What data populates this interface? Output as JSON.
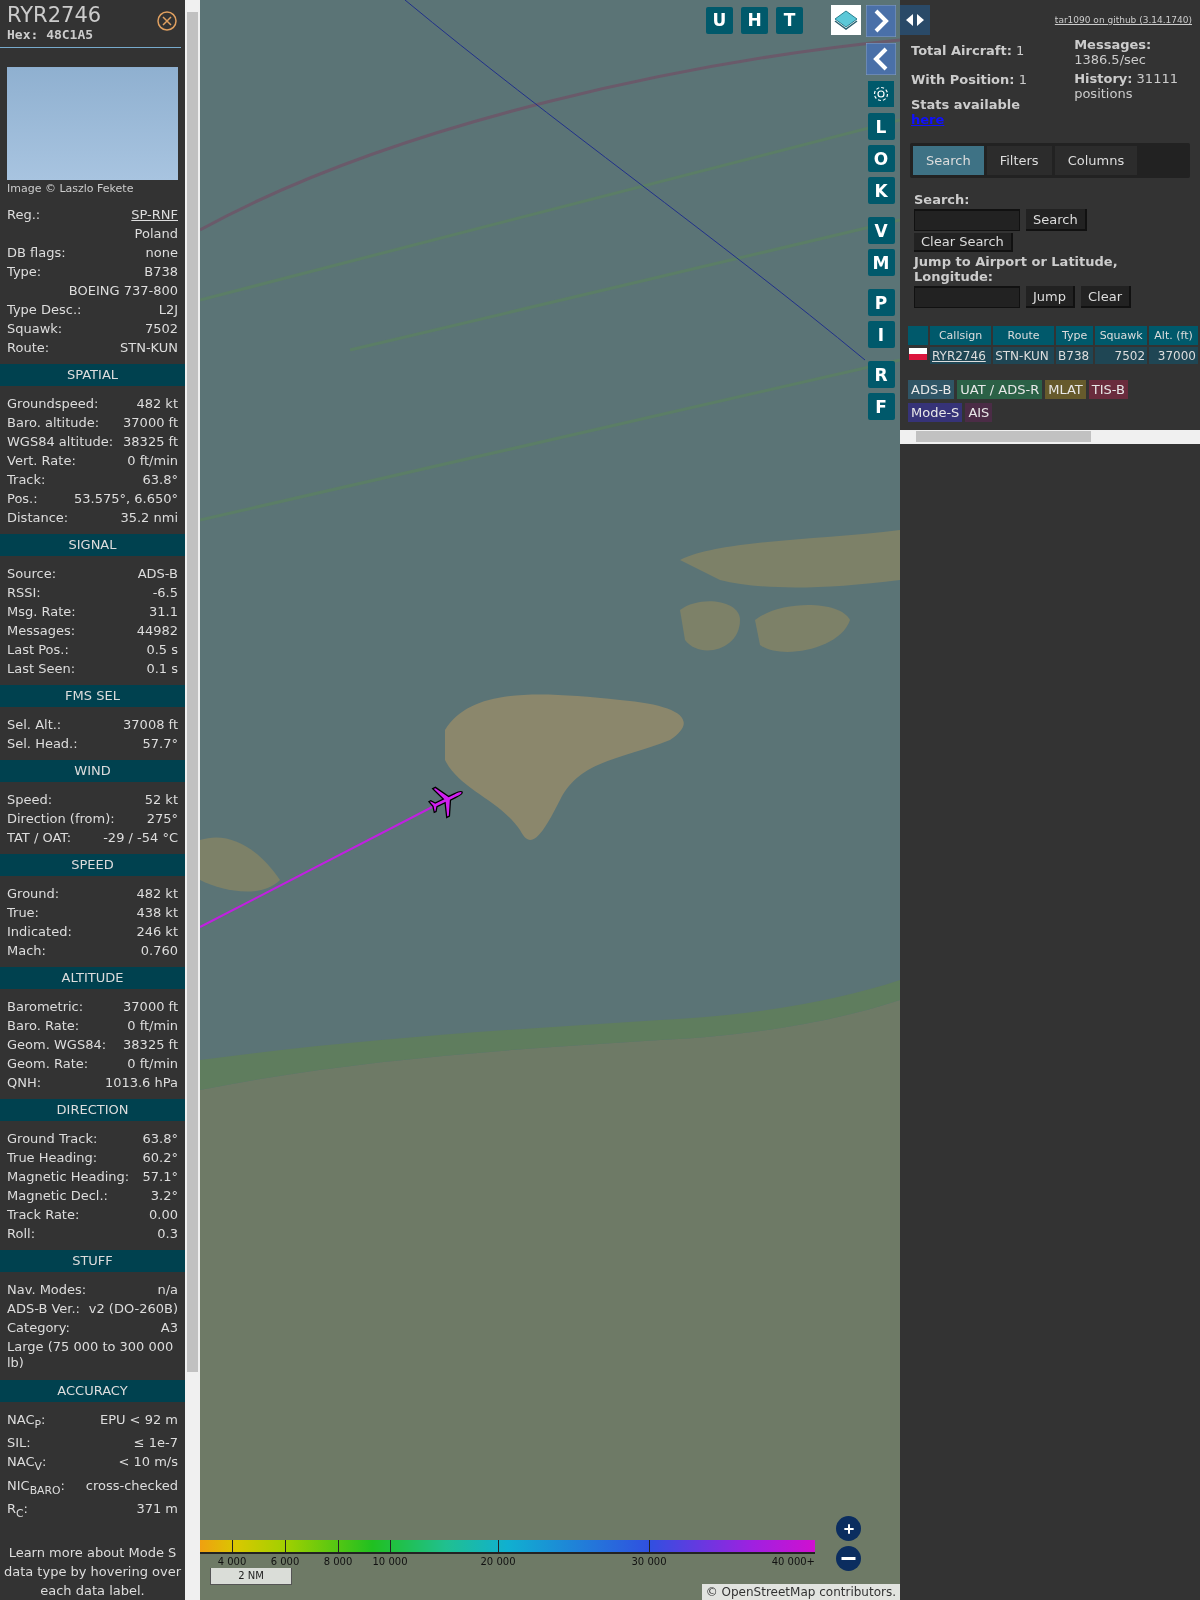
{
  "sidebar": {
    "title": "RYR2746",
    "hex": "Hex: 48C1A5",
    "photo_credit": "Image © Laszlo Fekete",
    "details": [
      {
        "kind": "link",
        "label": "Reg.:",
        "value": "SP-RNF"
      },
      {
        "kind": "value",
        "value": "Poland"
      },
      {
        "kind": "pair",
        "label": "DB flags:",
        "value": "none"
      },
      {
        "kind": "pair",
        "label": "Type:",
        "value": "B738"
      },
      {
        "kind": "value",
        "value": "BOEING 737-800"
      },
      {
        "kind": "pair",
        "label": "Type Desc.:",
        "value": "L2J"
      },
      {
        "kind": "pair",
        "label": "Squawk:",
        "value": "7502"
      },
      {
        "kind": "pair",
        "label": "Route:",
        "value": "STN-KUN"
      }
    ],
    "sections": [
      {
        "title": "SPATIAL",
        "rows": [
          {
            "kind": "pair",
            "label": "Groundspeed:",
            "value": "482 kt"
          },
          {
            "kind": "pair",
            "label": "Baro. altitude:",
            "value": "37000 ft"
          },
          {
            "kind": "pair",
            "label": "WGS84 altitude:",
            "value": "38325 ft"
          },
          {
            "kind": "pair",
            "label": "Vert. Rate:",
            "value": "0 ft/min"
          },
          {
            "kind": "pair",
            "label": "Track:",
            "value": "63.8°"
          },
          {
            "kind": "pair",
            "label": "Pos.:",
            "value": "53.575°, 6.650°"
          },
          {
            "kind": "pair",
            "label": "Distance:",
            "value": "35.2 nmi"
          }
        ]
      },
      {
        "title": "SIGNAL",
        "rows": [
          {
            "kind": "pair",
            "label": "Source:",
            "value": "ADS-B"
          },
          {
            "kind": "pair",
            "label": "RSSI:",
            "value": "-6.5"
          },
          {
            "kind": "pair",
            "label": "Msg. Rate:",
            "value": "31.1"
          },
          {
            "kind": "pair",
            "label": "Messages:",
            "value": "44982"
          },
          {
            "kind": "pair",
            "label": "Last Pos.:",
            "value": "0.5 s"
          },
          {
            "kind": "pair",
            "label": "Last Seen:",
            "value": "0.1 s"
          }
        ]
      },
      {
        "title": "FMS SEL",
        "rows": [
          {
            "kind": "pair",
            "label": "Sel. Alt.:",
            "value": "37008 ft"
          },
          {
            "kind": "pair",
            "label": "Sel. Head.:",
            "value": "57.7°"
          }
        ]
      },
      {
        "title": "WIND",
        "rows": [
          {
            "kind": "pair",
            "label": "Speed:",
            "value": "52 kt"
          },
          {
            "kind": "pair",
            "label": "Direction (from):",
            "value": "275°"
          },
          {
            "kind": "pair",
            "label": "TAT / OAT:",
            "value": "-29 / -54 °C"
          }
        ]
      },
      {
        "title": "SPEED",
        "rows": [
          {
            "kind": "pair",
            "label": "Ground:",
            "value": "482 kt"
          },
          {
            "kind": "pair",
            "label": "True:",
            "value": "438 kt"
          },
          {
            "kind": "pair",
            "label": "Indicated:",
            "value": "246 kt"
          },
          {
            "kind": "pair",
            "label": "Mach:",
            "value": "0.760"
          }
        ]
      },
      {
        "title": "ALTITUDE",
        "rows": [
          {
            "kind": "pair",
            "label": "Barometric:",
            "value": "37000 ft"
          },
          {
            "kind": "pair",
            "label": "Baro. Rate:",
            "value": "0 ft/min"
          },
          {
            "kind": "pair",
            "label": "Geom. WGS84:",
            "value": "38325 ft"
          },
          {
            "kind": "pair",
            "label": "Geom. Rate:",
            "value": "0 ft/min"
          },
          {
            "kind": "pair",
            "label": "QNH:",
            "value": "1013.6 hPa"
          }
        ]
      },
      {
        "title": "DIRECTION",
        "rows": [
          {
            "kind": "pair",
            "label": "Ground Track:",
            "value": "63.8°"
          },
          {
            "kind": "pair",
            "label": "True Heading:",
            "value": "60.2°"
          },
          {
            "kind": "pair",
            "label": "Magnetic Heading:",
            "value": "57.1°"
          },
          {
            "kind": "pair",
            "label": "Magnetic Decl.:",
            "value": "3.2°"
          },
          {
            "kind": "pair",
            "label": "Track Rate:",
            "value": "0.00"
          },
          {
            "kind": "pair",
            "label": "Roll:",
            "value": "0.3"
          }
        ]
      },
      {
        "title": "STUFF",
        "rows": [
          {
            "kind": "pair",
            "label": "Nav. Modes:",
            "value": "n/a"
          },
          {
            "kind": "pair",
            "label": "ADS-B Ver.:",
            "value": "v2 (DO-260B)"
          },
          {
            "kind": "pair",
            "label": "Category:",
            "value": "A3"
          },
          {
            "kind": "note",
            "value": "Large (75 000 to 300 000 lb)"
          }
        ]
      },
      {
        "title": "ACCURACY",
        "rows": [
          {
            "kind": "pair",
            "label": "NAC$_{P}$:",
            "value": "EPU < 92 m"
          },
          {
            "kind": "pair",
            "label": "SIL:",
            "value": "≤ 1e-7"
          },
          {
            "kind": "pair",
            "label": "NAC$_{V}$:",
            "value": "< 10 m/s"
          },
          {
            "kind": "pair",
            "label": "NIC$_{BARO}$:",
            "value": "cross-checked"
          },
          {
            "kind": "pair",
            "label": "R$_{C}$:",
            "value": "371 m"
          }
        ]
      }
    ],
    "footer_note": "Learn more about Mode S data type by hovering over each data label."
  },
  "map": {
    "top_buttons": [
      "U",
      "H",
      "T"
    ],
    "side_button_groups": [
      {
        "buttons": [
          "L",
          "O",
          "K"
        ]
      },
      {
        "buttons": [
          "V",
          "M"
        ]
      },
      {
        "buttons": [
          "P",
          "I"
        ]
      },
      {
        "buttons": [
          "R",
          "F"
        ]
      }
    ],
    "altitude_scale": [
      "4 000",
      "6 000",
      "8 000",
      "10 000",
      "20 000",
      "30 000",
      "40 000+"
    ],
    "scale_bar": "2 NM",
    "attribution": "© OpenStreetMap contributors."
  },
  "panel": {
    "top_link": "tar1090 on github (3.14.1740)",
    "stats_left": [
      {
        "label": "Total Aircraft:",
        "value": "1"
      },
      {
        "label": "With Position:",
        "value": "1"
      }
    ],
    "stats_link_label": "Stats available",
    "stats_link": "here",
    "stats_right": [
      {
        "label": "Messages:",
        "value": "1386.5/sec"
      },
      {
        "label": "History:",
        "value": "31111 positions"
      }
    ],
    "tabs": [
      {
        "label": "Search",
        "selected": true
      },
      {
        "label": "Filters",
        "selected": false
      },
      {
        "label": "Columns",
        "selected": false
      }
    ],
    "search": {
      "label": "Search:",
      "button": "Search",
      "clear_button": "Clear Search",
      "jump_label": "Jump to Airport or Latitude, Longitude:",
      "jump_button": "Jump",
      "jump_clear_button": "Clear"
    },
    "table": {
      "columns": [
        "Callsign",
        "Route",
        "Type",
        "Squawk",
        "Alt. (ft)"
      ],
      "rows": [
        {
          "callsign": "RYR2746",
          "route": "STN-KUN",
          "type": "B738",
          "squawk": "7502",
          "altitude": "37000"
        }
      ]
    },
    "legend": [
      {
        "label": "ADS-B",
        "color": "#2f5566"
      },
      {
        "label": "UAT / ADS-R",
        "color": "#2b6146"
      },
      {
        "label": "MLAT",
        "color": "#665a2c"
      },
      {
        "label": "TIS-B",
        "color": "#6a2c3d"
      },
      {
        "label": "Mode-S",
        "color": "#363378"
      },
      {
        "label": "AIS",
        "color": "#4b2c46"
      }
    ]
  }
}
